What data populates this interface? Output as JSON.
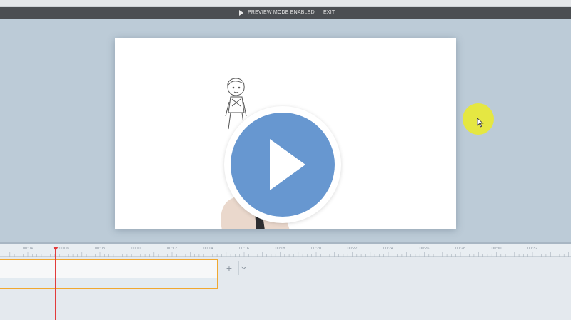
{
  "preview_bar": {
    "mode_text": "PREVIEW MODE ENABLED",
    "exit_label": "EXIT"
  },
  "video": {
    "play_icon": "play-icon"
  },
  "timeline": {
    "tick_labels": [
      "00:04",
      "00:06",
      "00:08",
      "00:10",
      "00:12",
      "00:14",
      "00:16",
      "00:18",
      "00:20",
      "00:22",
      "00:24",
      "00:26",
      "00:28",
      "00:30",
      "00:32"
    ],
    "add_icon": "plus-icon",
    "dropdown_icon": "chevron-down-icon"
  },
  "colors": {
    "background": "#bccbd7",
    "preview_bar": "#4b4e52",
    "play_button": "#5a8ecc",
    "cursor_highlight": "#ecec28",
    "playhead": "#e23b3b",
    "clip_border": "#f0a830"
  }
}
